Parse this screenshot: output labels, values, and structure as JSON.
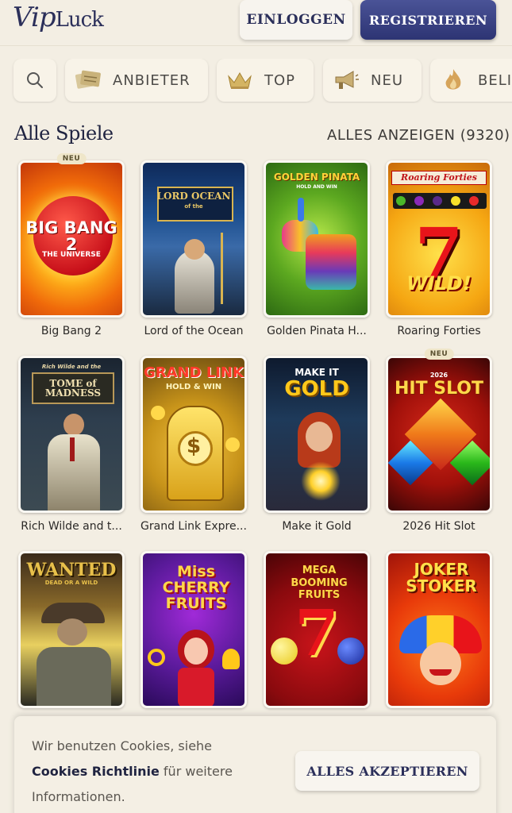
{
  "header": {
    "logo_vip": "Vip",
    "logo_luck": "Luck",
    "login_label": "EINLOGGEN",
    "register_label": "REGISTRIEREN"
  },
  "categories": [
    {
      "label": "ANBIETER",
      "icon": "provider-icon"
    },
    {
      "label": "TOP",
      "icon": "crown-icon"
    },
    {
      "label": "NEU",
      "icon": "megaphone-icon"
    },
    {
      "label": "BELI",
      "icon": "flame-icon"
    }
  ],
  "section": {
    "title": "Alle Spiele",
    "show_all": "ALLES ANZEIGEN (9320)"
  },
  "badge_new": "NEU",
  "games": [
    {
      "name": "Big Bang 2",
      "art_title": "BIG BANG 2",
      "art_sub": "THE UNIVERSE",
      "new": true
    },
    {
      "name": "Lord of the Ocean",
      "art_title": "LORD OCEAN",
      "art_sub": "of the",
      "new": false
    },
    {
      "name": "Golden Pinata H...",
      "art_title": "GOLDEN PINATA",
      "art_sub": "HOLD AND WIN",
      "new": false
    },
    {
      "name": "Roaring Forties",
      "art_title": "Roaring Forties",
      "art_sub": "WILD!",
      "new": false
    },
    {
      "name": "Rich Wilde and t...",
      "art_title": "TOME of MADNESS",
      "art_sub": "Rich Wilde and the",
      "new": false
    },
    {
      "name": "Grand Link Expre...",
      "art_title": "GRAND LINK",
      "art_sub": "HOLD & WIN",
      "new": false
    },
    {
      "name": "Make it Gold",
      "art_title": "MAKE IT",
      "art_sub": "GOLD",
      "new": false
    },
    {
      "name": "2026 Hit Slot",
      "art_title": "HIT SLOT",
      "art_sub": "2026",
      "new": true
    },
    {
      "name": "",
      "art_title": "WANTED",
      "art_sub": "DEAD OR A WILD",
      "new": false
    },
    {
      "name": "",
      "art_title": "Miss CHERRY FRUITS",
      "art_sub": "",
      "new": false
    },
    {
      "name": "",
      "art_title": "MEGA BOOMING FRUITS",
      "art_sub": "",
      "new": false
    },
    {
      "name": "",
      "art_title": "JOKER STOKER",
      "art_sub": "",
      "new": false
    }
  ],
  "cookie": {
    "text_before": "Wir benutzen Cookies, siehe",
    "policy_link": "Cookies Richtlinie",
    "text_after": "für weitere Informationen.",
    "accept_label": "ALLES AKZEPTIEREN"
  },
  "colors": {
    "background": "#f3eee3",
    "brand_navy": "#2b2f5a",
    "register_bg": "#3a4183"
  }
}
